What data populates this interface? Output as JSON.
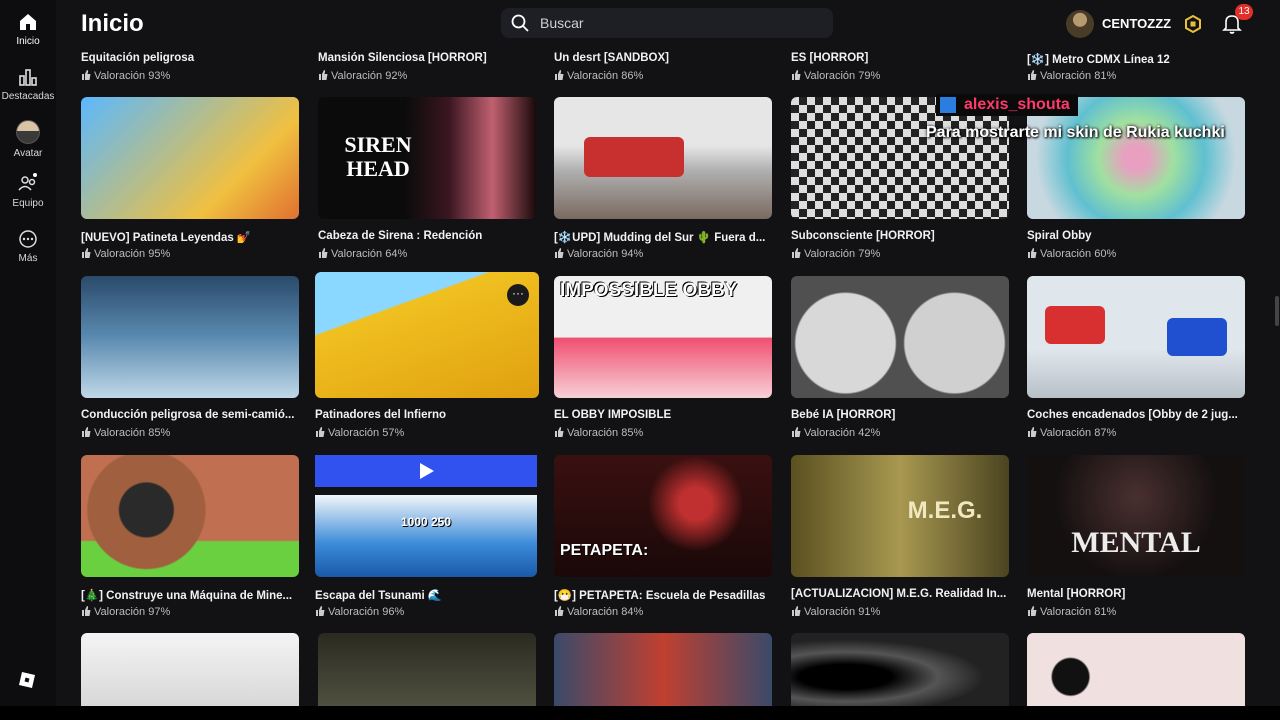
{
  "header": {
    "title": "Inicio",
    "search_placeholder": "Buscar",
    "username": "CENTOZZZ",
    "notification_count": "13"
  },
  "sidebar": {
    "items": [
      {
        "label": "Inicio"
      },
      {
        "label": "Destacadas"
      },
      {
        "label": "Avatar"
      },
      {
        "label": "Equipo"
      },
      {
        "label": "Más"
      }
    ]
  },
  "overlay": {
    "name": "alexis_shouta",
    "message": "Para mostrarte mi skin de Rukia kuchki"
  },
  "top_row": [
    {
      "title": "Equitación peligrosa",
      "rating": "Valoración 93%"
    },
    {
      "title": "Mansión Silenciosa [HORROR]",
      "rating": "Valoración 92%"
    },
    {
      "title": "Un desrt [SANDBOX]",
      "rating": "Valoración 86%"
    },
    {
      "title": "ES [HORROR]",
      "rating": "Valoración 79%"
    },
    {
      "title": "[❄️] Metro CDMX Línea 12",
      "rating": "Valoración 81%"
    }
  ],
  "games": [
    {
      "title": "[NUEVO] Patineta Leyendas 💅",
      "rating": "Valoración 95%",
      "thumb": ""
    },
    {
      "title": "Cabeza de Sirena : Redención",
      "rating": "Valoración 64%",
      "thumb": "SIREN HEAD"
    },
    {
      "title": "[❄️UPD] Mudding del Sur 🌵 Fuera d...",
      "rating": "Valoración 94%",
      "thumb": ""
    },
    {
      "title": "Subconsciente [HORROR]",
      "rating": "Valoración 79%",
      "thumb": ""
    },
    {
      "title": "Spiral Obby",
      "rating": "Valoración 60%",
      "thumb": ""
    },
    {
      "title": "Conducción peligrosa de semi-camió...",
      "rating": "Valoración 85%",
      "thumb": ""
    },
    {
      "title": "Patinadores del Infierno",
      "rating": "Valoración 57%",
      "thumb": ""
    },
    {
      "title": "EL OBBY IMPOSIBLE",
      "rating": "Valoración 85%",
      "thumb": "IMPOSSIBLE OBBY"
    },
    {
      "title": "Bebé IA [HORROR]",
      "rating": "Valoración 42%",
      "thumb": ""
    },
    {
      "title": "Coches encadenados [Obby de 2 jug...",
      "rating": "Valoración 87%",
      "thumb": ""
    },
    {
      "title": "[🎄] Construye una Máquina de Mine...",
      "rating": "Valoración 97%",
      "thumb": ""
    },
    {
      "title": "Escapa del Tsunami 🌊",
      "rating": "Valoración 96%",
      "thumb": "1000 250"
    },
    {
      "title": "[😷] PETAPETA: Escuela de Pesadillas",
      "rating": "Valoración 84%",
      "thumb": "PETAPETA:"
    },
    {
      "title": "[ACTUALIZACIÓN] M.E.G. Realidad In...",
      "rating": "Valoración 91%",
      "thumb": "M.E.G."
    },
    {
      "title": "Mental [HORROR]",
      "rating": "Valoración 81%",
      "thumb": "MENTAL"
    }
  ]
}
